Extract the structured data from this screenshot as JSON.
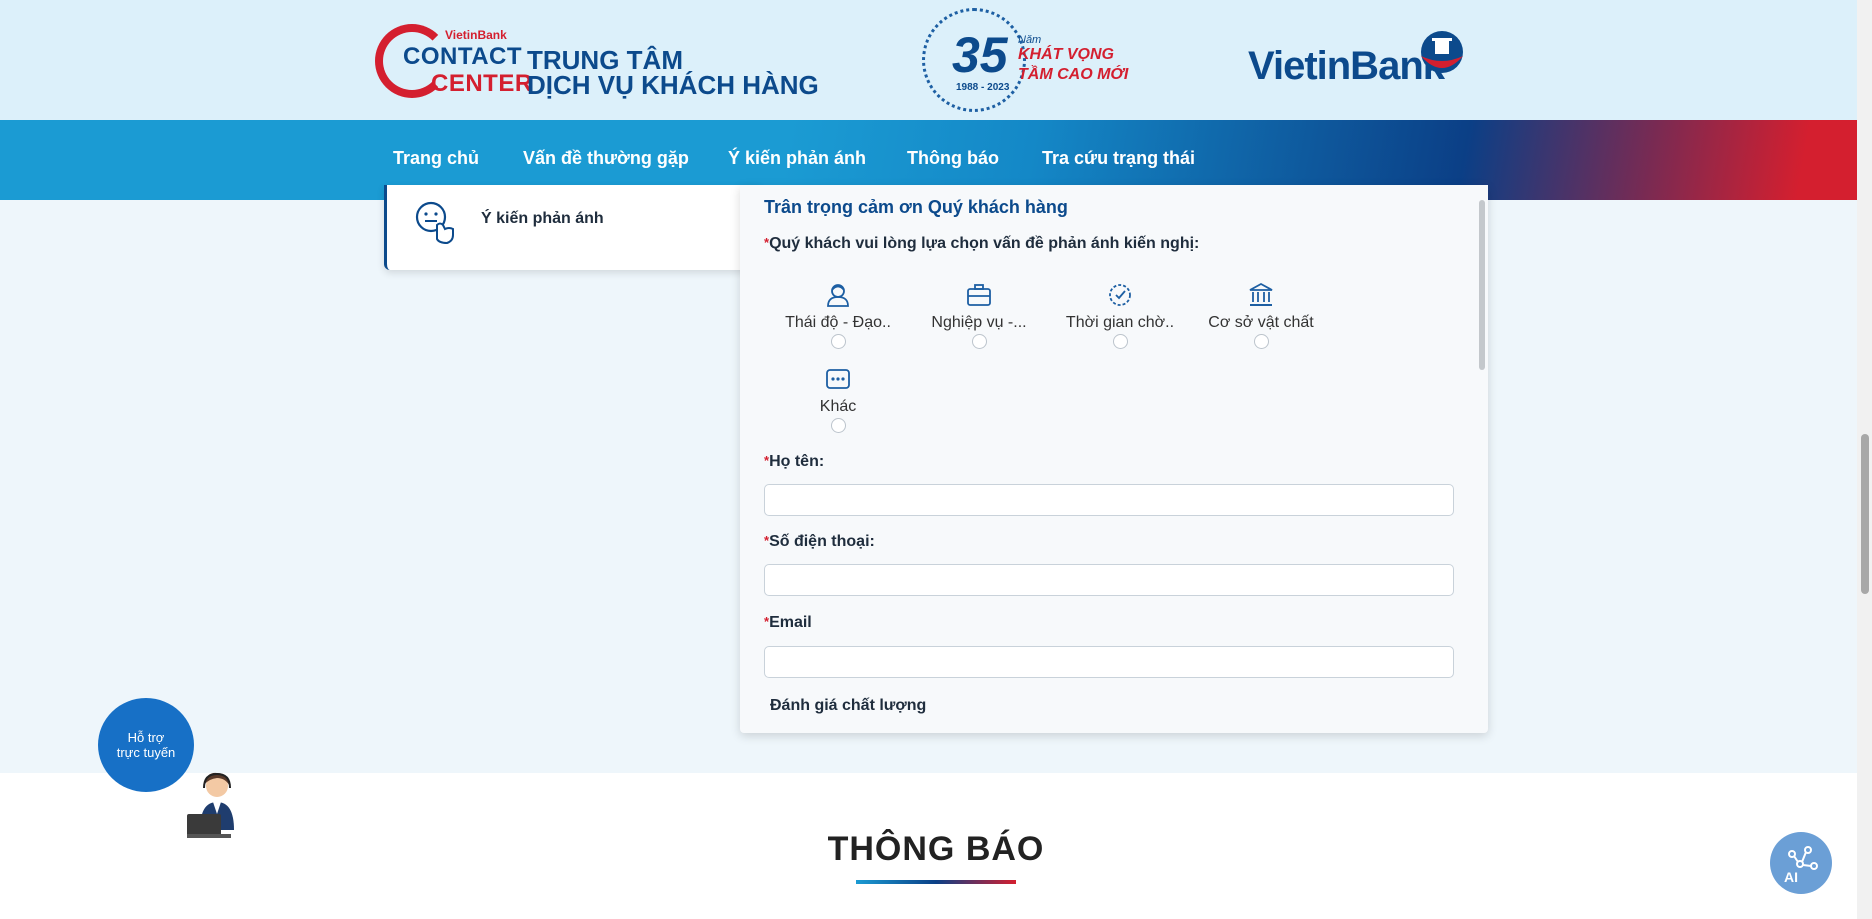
{
  "header": {
    "cc_small": "VietinBank",
    "cc_contact": "CONTACT",
    "cc_center": "CENTER",
    "cc_title_line1": "TRUNG TÂM",
    "cc_title_line2": "DỊCH VỤ KHÁCH HÀNG",
    "anniv_number": "35",
    "anniv_nam": "Năm",
    "anniv_years": "1988 - 2023",
    "anniv_slogan1": "KHÁT VỌNG",
    "anniv_slogan2": "TẦM CAO MỚI",
    "brand": "VietinBank"
  },
  "nav": {
    "items": [
      {
        "label": "Trang chủ"
      },
      {
        "label": "Vấn đề thường gặp"
      },
      {
        "label": "Ý kiến phản ánh"
      },
      {
        "label": "Thông báo"
      },
      {
        "label": "Tra cứu trạng thái"
      }
    ]
  },
  "side_card": {
    "label": "Ý kiến phản ánh",
    "icon": "feedback-hand-icon"
  },
  "form": {
    "thanks": "Trân trọng cảm ơn Quý khách hàng",
    "question_required": "*",
    "question": "Quý khách vui lòng lựa chọn vấn đề phản ánh kiến nghị:",
    "options": [
      {
        "label": "Thái độ - Đạo..",
        "icon": "staff-icon"
      },
      {
        "label": "Nghiệp vụ -...",
        "icon": "briefcase-icon"
      },
      {
        "label": "Thời gian chờ..",
        "icon": "clock-icon"
      },
      {
        "label": "Cơ sở vật chất",
        "icon": "bank-building-icon"
      },
      {
        "label": "Khác",
        "icon": "more-icon"
      }
    ],
    "name_label": "Họ tên:",
    "name_value": "",
    "phone_label": "Số điện thoại:",
    "phone_value": "",
    "email_label": "Email",
    "email_value": "",
    "rating_label": "Đánh giá chất lượng"
  },
  "section": {
    "title": "THÔNG BÁO"
  },
  "support": {
    "line1": "Hỗ trợ",
    "line2": "trực tuyến"
  },
  "ai_button": {
    "icon": "ai-network-icon",
    "label": "AI"
  },
  "colors": {
    "primary": "#0c4a8c",
    "accent": "#d41f2f",
    "nav_blue": "#1b9bd3",
    "support_blue": "#1770c6"
  }
}
